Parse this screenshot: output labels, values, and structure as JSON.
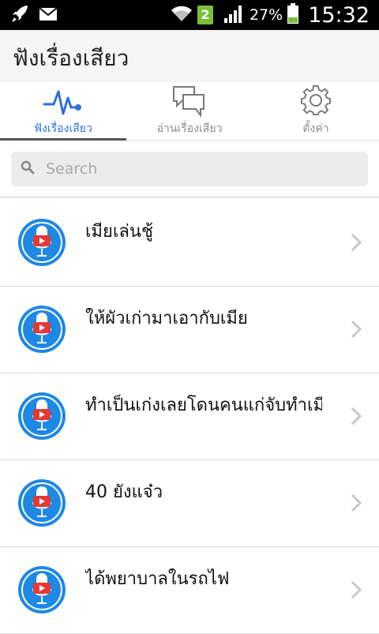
{
  "status_bar": {
    "sim_number": "2",
    "battery": "27%",
    "time": "15:32"
  },
  "app": {
    "title": "ฟังเรื่องเสียว"
  },
  "tabs": [
    {
      "label": "ฟังเรื่องเสียว",
      "icon": "pulse-icon",
      "active": true
    },
    {
      "label": "อ่านเรื่องเสียว",
      "icon": "chat-bubbles-icon",
      "active": false
    },
    {
      "label": "ตั้งค่า",
      "icon": "gear-icon",
      "active": false
    }
  ],
  "search": {
    "placeholder": "Search",
    "value": ""
  },
  "items": [
    {
      "title": "เมียเล่นชู้"
    },
    {
      "title": "ให้ผัวเก่ามาเอากับเมีย"
    },
    {
      "title": "ทำเป็นเก่งเลยโดนคนแก่จับทำเมี"
    },
    {
      "title": "40 ยังแจ๋ว"
    },
    {
      "title": "ได้พยาบาลในรถไฟ"
    }
  ],
  "colors": {
    "accent": "#2f6fe0",
    "avatar_blue": "#1e88e5",
    "youtube_red": "#e53935"
  }
}
